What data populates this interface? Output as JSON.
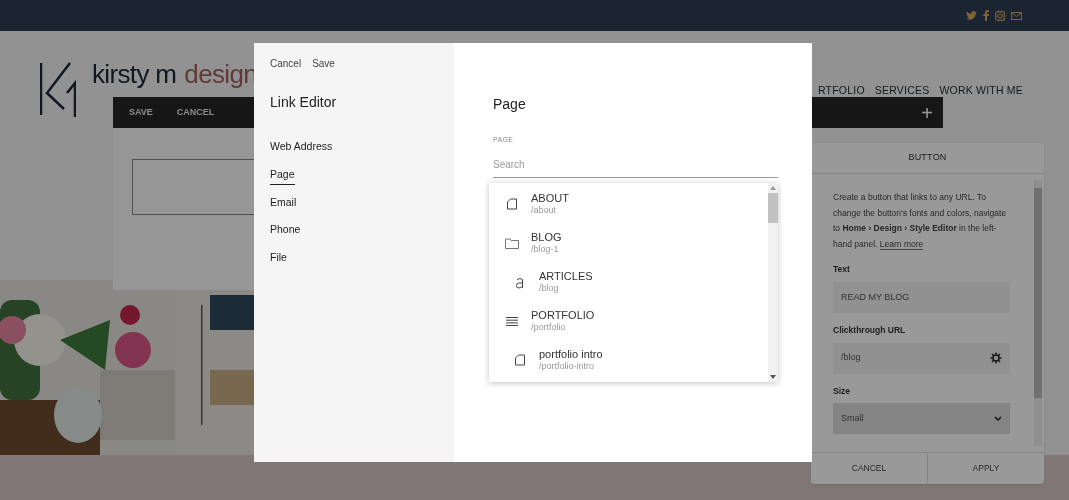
{
  "site": {
    "logo": {
      "name": "kirsty m",
      "accent": "design"
    },
    "nav": [
      "RTFOLIO",
      "SERVICES",
      "WORK WITH ME"
    ]
  },
  "editor_bar": {
    "buttons": [
      "SAVE",
      "CANCEL"
    ],
    "add": "+"
  },
  "button_panel": {
    "title": "BUTTON",
    "description": "Create a button that links to any URL. To change the button's fonts and colors, navigate to **Home › Design › Style Editor** in the left-hand panel.",
    "learn_more": "Learn more",
    "fields": [
      {
        "kind": "text",
        "label": "Text",
        "value": "READ MY BLOG"
      },
      {
        "kind": "url",
        "label": "Clickthrough URL",
        "value": "/blog"
      },
      {
        "kind": "select",
        "label": "Size",
        "value": "Small"
      }
    ],
    "buttons": [
      "CANCEL",
      "APPLY"
    ]
  },
  "link_editor": {
    "actions": [
      "Cancel",
      "Save"
    ],
    "title": "Link Editor",
    "types": [
      {
        "label": "Web Address",
        "selected": false
      },
      {
        "label": "Page",
        "selected": true
      },
      {
        "label": "Email",
        "selected": false
      },
      {
        "label": "Phone",
        "selected": false
      },
      {
        "label": "File",
        "selected": false
      }
    ],
    "section_title": "Page",
    "field_label": "PAGE",
    "search": {
      "placeholder": "Search"
    },
    "pages": [
      {
        "kind": "page",
        "title": "ABOUT",
        "path": "/about"
      },
      {
        "kind": "folder",
        "title": "BLOG",
        "path": "/blog-1",
        "children": [
          {
            "kind": "collection",
            "title": "ARTICLES",
            "path": "/blog"
          }
        ]
      },
      {
        "kind": "index",
        "title": "PORTFOLIO",
        "path": "/portfolio",
        "children": [
          {
            "kind": "page",
            "title": "portfolio intro",
            "path": "/portfolio-intro"
          }
        ]
      }
    ]
  }
}
